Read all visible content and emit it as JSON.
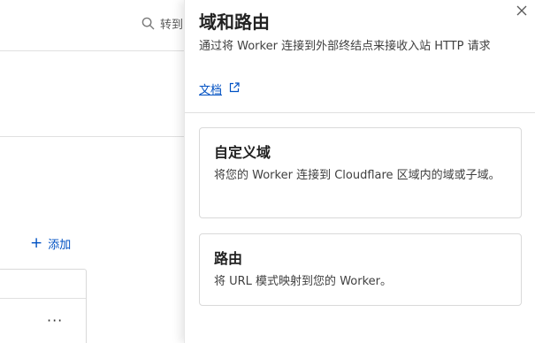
{
  "background": {
    "search_text": "转到",
    "add_button_label": "添加",
    "kebab_label": "···"
  },
  "panel": {
    "title": "域和路由",
    "description": "通过将 Worker 连接到外部终结点来接收入站 HTTP 请求",
    "docs_link_label": "文档",
    "options": [
      {
        "title": "自定义域",
        "description": "将您的 Worker 连接到 Cloudflare 区域内的域或子域。"
      },
      {
        "title": "路由",
        "description": "将 URL 模式映射到您的 Worker。"
      }
    ]
  },
  "colors": {
    "link": "#0051c3",
    "text": "#313131",
    "border": "#d9d9d9"
  }
}
